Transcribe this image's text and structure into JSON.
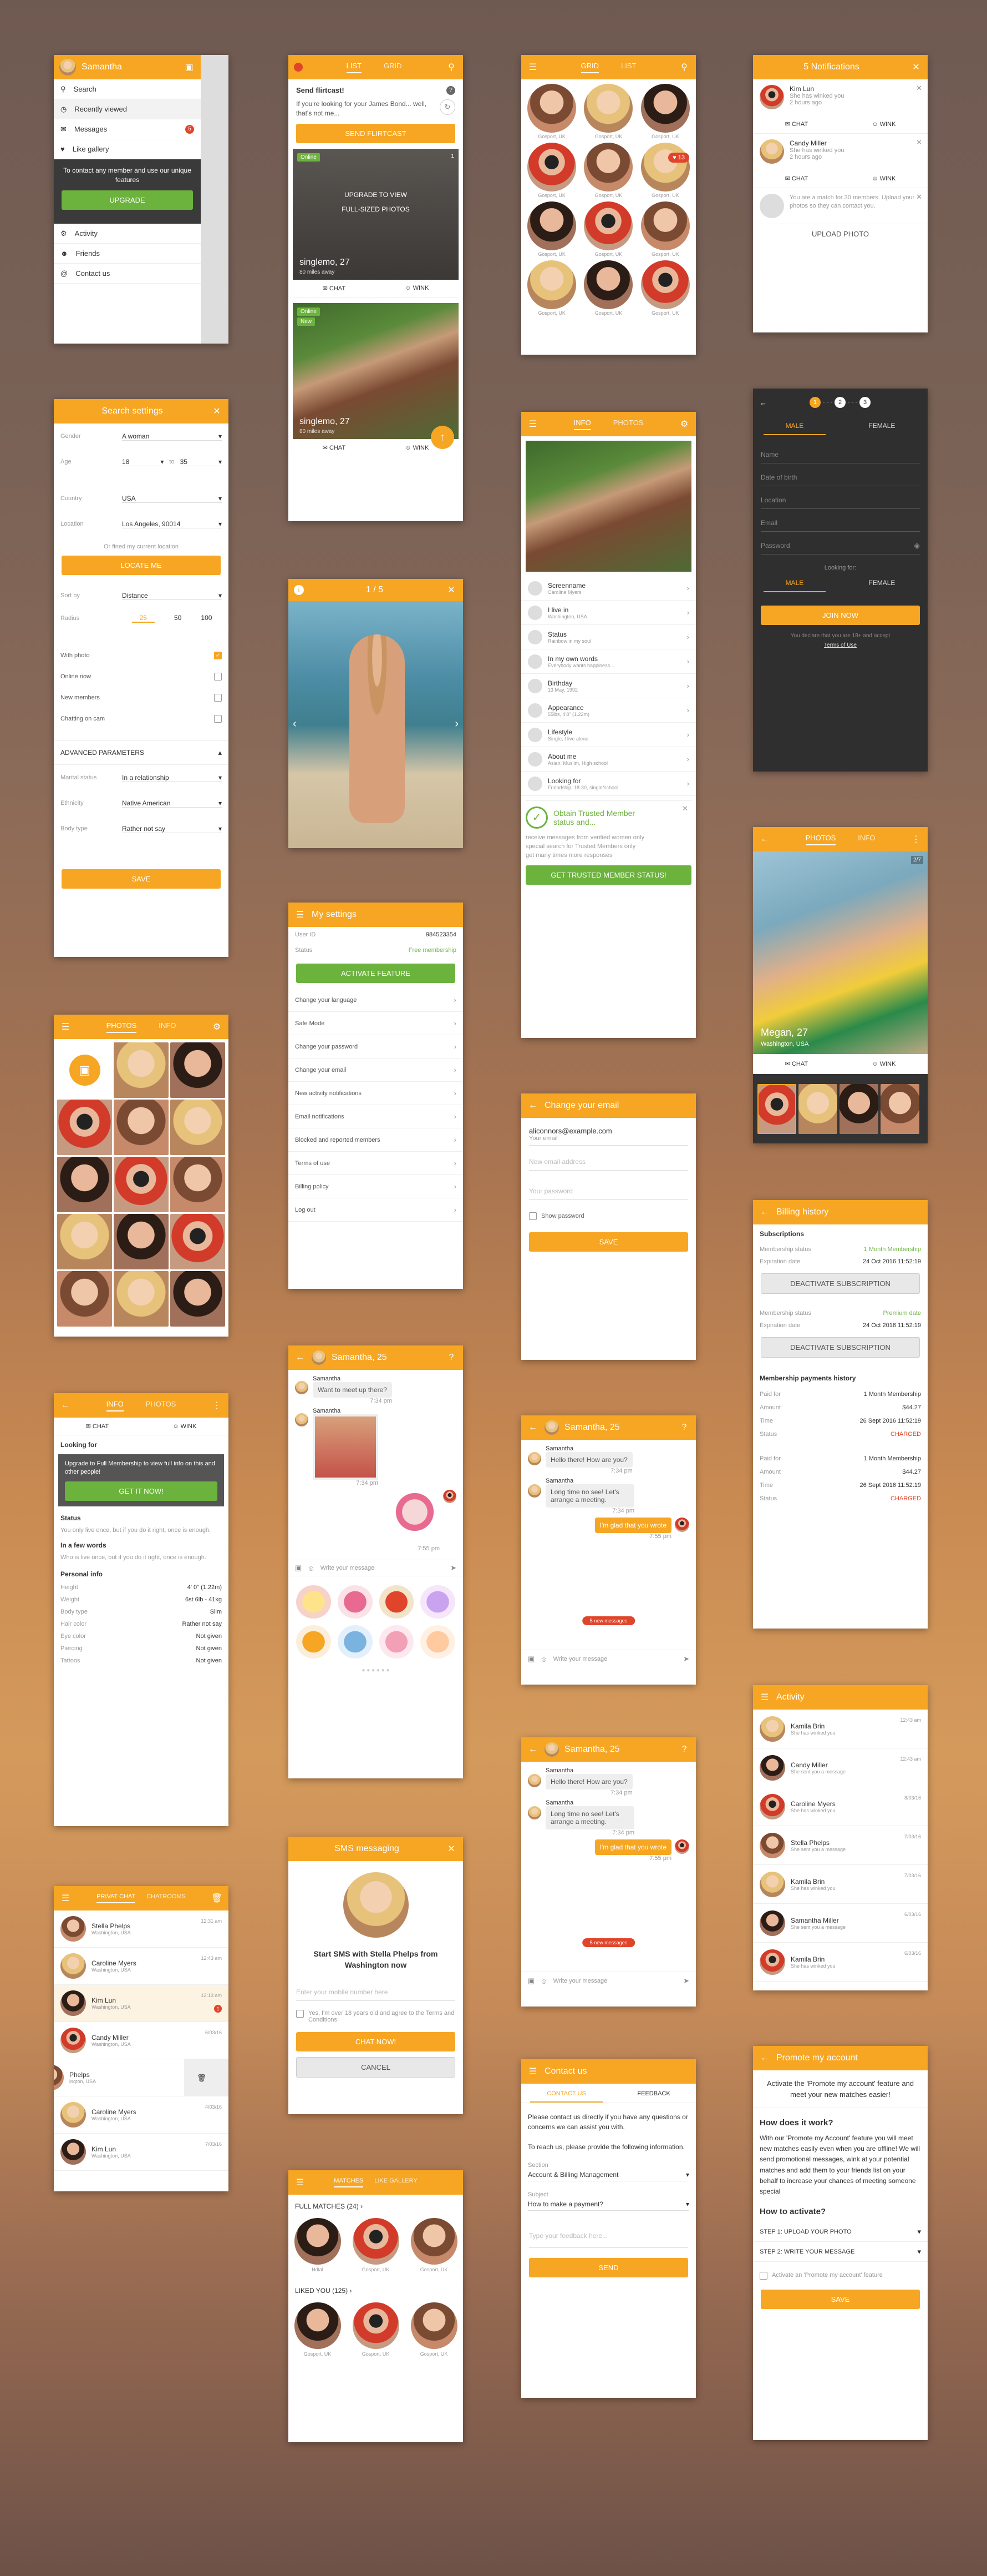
{
  "s1": {
    "user": "Samantha",
    "items": [
      "Search",
      "Recently viewed",
      "Messages",
      "Like gallery"
    ],
    "badge": "5",
    "promo": "To contact any member and use our unique features",
    "upgrade": "UPGRADE",
    "items2": [
      "Activity",
      "Friends",
      "Contact us"
    ]
  },
  "s2": {
    "tab_list": "LIST",
    "tab_grid": "GRID",
    "title": "Send flirtcast!",
    "text": "If you're looking for your James Bond... well, that's not me...",
    "send": "SEND FLIRTCAST",
    "online": "Online",
    "count1": "1",
    "upgrade_text1": "UPGRADE TO VIEW",
    "upgrade_text2": "FULL-SIZED PHOTOS",
    "name1": "singlemo, 27",
    "dist1": "80 miles away",
    "chat": "CHAT",
    "wink": "WINK",
    "new": "New",
    "name2": "singlemo, 27",
    "dist2": "80 miles away"
  },
  "s3": {
    "tab_grid": "GRID",
    "tab_list": "LIST",
    "captions": [
      "Gosport, UK",
      "Gosport, UK",
      "Gosport, UK",
      "Gosport, UK",
      "Gosport, UK",
      "Gosport, UK",
      "Gosport, UK",
      "Gosport, UK",
      "Gosport, UK",
      "Gosport, UK",
      "Gosport, UK",
      "Gosport, UK"
    ],
    "badge": "13"
  },
  "s4": {
    "title": "5 Notifications",
    "n1_name": "Kim Lun",
    "n1_text": "She has winked you",
    "n1_time": "2 hours ago",
    "n2_name": "Candy Miller",
    "n2_text": "She has winked you",
    "n2_time": "2 hours ago",
    "n3_text": "You are a match for 30 members. Upload your photos so they can contact you.",
    "chat": "CHAT",
    "wink": "WINK",
    "upload": "UPLOAD PHOTO"
  },
  "s5": {
    "title": "Search settings",
    "gender_l": "Gender",
    "gender_v": "A woman",
    "age_l": "Age",
    "age_from": "18",
    "age_to": "35",
    "to": "to",
    "country_l": "Country",
    "country_v": "USA",
    "location_l": "Location",
    "location_v": "Los Angeles, 90014",
    "hint": "Or fined my current location",
    "locate": "LOCATE ME",
    "sort_l": "Sort by",
    "sort_v": "Distance",
    "radius_l": "Radius",
    "r1": "25",
    "r2": "50",
    "r3": "100",
    "c1": "With photo",
    "c2": "Online now",
    "c3": "New members",
    "c4": "Chatting on cam",
    "adv": "ADVANCED PARAMETERS",
    "m_l": "Marital status",
    "m_v": "In a relationship",
    "e_l": "Ethnicity",
    "e_v": "Native American",
    "b_l": "Body type",
    "b_v": "Rather not say",
    "save": "SAVE"
  },
  "s6": {
    "counter": "1 / 5"
  },
  "s7": {
    "tab_info": "INFO",
    "tab_photos": "PHOTOS",
    "fields": [
      {
        "l": "Screenname",
        "v": "Caroline Myers"
      },
      {
        "l": "I live in",
        "v": "Washington, USA"
      },
      {
        "l": "Status",
        "v": "Rainbow in my soul"
      },
      {
        "l": "In my own words",
        "v": "Everybody wants happiness..."
      },
      {
        "l": "Birthday",
        "v": "13 May, 1992"
      },
      {
        "l": "Appearance",
        "v": "55lbs, 4'8\" (1.22m)"
      },
      {
        "l": "Lifestyle",
        "v": "Single, I live alone"
      },
      {
        "l": "About me",
        "v": "Asian, Muslim, High school"
      },
      {
        "l": "Looking for",
        "v": "Friendship, 18-30, single/school"
      }
    ],
    "trust_title": "Obtain Trusted Member status and...",
    "trust_items": [
      "receive messages from verified women only",
      "special search for Trusted Members only",
      "get many times more responses"
    ],
    "trust_btn": "GET TRUSTED MEMBER STATUS!"
  },
  "s8": {
    "step1": "1",
    "step2": "2",
    "step3": "3",
    "male": "MALE",
    "female": "FEMALE",
    "fields": [
      "Name",
      "Date of birth",
      "Location",
      "Email",
      "Password"
    ],
    "looking": "Looking for:",
    "male2": "MALE",
    "female2": "FEMALE",
    "join": "JOIN NOW",
    "legal": "You declare that you are 18+ and accept",
    "terms": "Terms of Use"
  },
  "s9": {
    "tab_photos": "PHOTOS",
    "tab_info": "INFO",
    "count": "2/7",
    "name": "Megan, 27",
    "loc": "Washington, USA",
    "chat": "CHAT",
    "wink": "WINK"
  },
  "s10": {
    "title": "My settings",
    "uid_l": "User ID",
    "uid_v": "984523354",
    "status_l": "Status",
    "status_v": "Free membership",
    "activate": "ACTIVATE FEATURE",
    "items": [
      "Change your language",
      "Safe Mode",
      "Change your password",
      "Change your email",
      "New activity notifications",
      "Email notifications",
      "Blocked and reported members",
      "Terms of use",
      "Billing policy",
      "Log out"
    ]
  },
  "s11": {
    "tab_photos": "PHOTOS",
    "tab_info": "INFO"
  },
  "s12": {
    "title": "Change your email",
    "email": "aliconnors@example.com",
    "email_l": "Your email",
    "new_ph": "New email address",
    "pw_ph": "Your password",
    "show": "Show password",
    "save": "SAVE"
  },
  "s13": {
    "tab_info": "INFO",
    "tab_photos": "PHOTOS",
    "chat": "CHAT",
    "wink": "WINK",
    "looking": "Looking for",
    "upg": "Upgrade to Full Membership to view full info on this and other people!",
    "getit": "GET IT NOW!",
    "status_h": "Status",
    "status_t": "You only live once, but if you do it right, once is enough.",
    "words_h": "In a few words",
    "words_t": "Who is live once, but if you do it right, once is enough.",
    "pinfo": "Personal info",
    "rows": [
      {
        "l": "Height",
        "v": "4' 0\" (1.22m)"
      },
      {
        "l": "Weight",
        "v": "6st 6lb - 41kg"
      },
      {
        "l": "Body type",
        "v": "Slim"
      },
      {
        "l": "Hair color",
        "v": "Rather not say"
      },
      {
        "l": "Eye color",
        "v": "Not given"
      },
      {
        "l": "Piercing",
        "v": "Not given"
      },
      {
        "l": "Tattoos",
        "v": "Not given"
      }
    ]
  },
  "s14": {
    "title": "Samantha, 25",
    "sender": "Samantha",
    "m1": "Want to meet up there?",
    "t1": "7:34 pm",
    "t2": "7:34 pm",
    "t3": "7:55 pm",
    "input": "Write your message"
  },
  "s15": {
    "title": "Samantha, 25",
    "sender": "Samantha",
    "m1": "Hello there! How are you?",
    "t1": "7:34 pm",
    "m2": "Long time no see! Let's arrange a meeting.",
    "t2": "7:34 pm",
    "m3": "I'm glad that you wrote",
    "t3": "7:55 pm",
    "more": "5 new messages",
    "input": "Write your message"
  },
  "s16": {
    "title": "Billing history",
    "subs": "Subscriptions",
    "ms_l": "Membership status",
    "ms_v": "1 Month Membership",
    "ed_l": "Expiration date",
    "ed_v": "24 Oct 2016 11:52:19",
    "deact": "DEACTIVATE SUBSCRIPTION",
    "ms2_v": "Premium date",
    "ed2_v": "24 Oct 2016 11:52:19",
    "deact2": "DEACTIVATE SUBSCRIPTION",
    "hist": "Membership payments history",
    "p1": [
      {
        "l": "Paid for",
        "v": "1 Month Membership"
      },
      {
        "l": "Amount",
        "v": "$44.27"
      },
      {
        "l": "Time",
        "v": "26 Sept 2016 11:52:19"
      },
      {
        "l": "Status",
        "v": "CHARGED"
      }
    ],
    "p2": [
      {
        "l": "Paid for",
        "v": "1 Month Membership"
      },
      {
        "l": "Amount",
        "v": "$44.27"
      },
      {
        "l": "Time",
        "v": "26 Sept 2016 11:52:19"
      },
      {
        "l": "Status",
        "v": "CHARGED"
      }
    ]
  },
  "s17": {
    "tab_private": "PRIVAT CHAT",
    "tab_rooms": "CHATROOMS",
    "items": [
      {
        "n": "Stella Phelps",
        "s": "Washington, USA",
        "t": "12:31 am"
      },
      {
        "n": "Caroline Myers",
        "s": "Washington, USA",
        "t": "12:43 am"
      },
      {
        "n": "Kim Lun",
        "s": "Washington, USA",
        "t": "12:13 am"
      },
      {
        "n": "Candy Miller",
        "s": "Washington, USA",
        "t": "6/03/16"
      },
      {
        "n": "Phelps",
        "s": "ington, USA",
        "t": "6/03/16"
      },
      {
        "n": "Caroline Myers",
        "s": "Washington, USA",
        "t": "4/03/16"
      },
      {
        "n": "Kim Lun",
        "s": "Washington, USA",
        "t": "7/03/16"
      }
    ],
    "badge": "1"
  },
  "s18": {
    "title": "SMS messaging",
    "head": "Start SMS with Stella Phelps from Washington now",
    "ph": "Enter your mobile number here",
    "agree": "Yes, I'm over 18 years old and agree to the Terms and Conditions",
    "chat": "CHAT NOW!",
    "cancel": "CANCEL"
  },
  "s19": {
    "title": "Samantha, 25",
    "sender": "Samantha",
    "m1": "Hello there! How are you?",
    "t1": "7:34 pm",
    "m2": "Long time no see! Let's arrange a meeting.",
    "t2": "7:34 pm",
    "m3": "I'm glad that you wrote",
    "t3": "7:55 pm",
    "more": "5 new messages",
    "input": "Write your message"
  },
  "s20": {
    "title": "Activity",
    "items": [
      {
        "n": "Kamila Brin",
        "s": "She has winked you",
        "t": "12:43 am"
      },
      {
        "n": "Candy Miller",
        "s": "She sent you a message",
        "t": "12:43 am"
      },
      {
        "n": "Caroline Myers",
        "s": "She has winked you",
        "t": "8/03/16"
      },
      {
        "n": "Stella Phelps",
        "s": "She sent you a message",
        "t": "7/03/16"
      },
      {
        "n": "Kamila Brin",
        "s": "She has winked you",
        "t": "7/03/16"
      },
      {
        "n": "Samantha Miller",
        "s": "She sent you a message",
        "t": "6/03/16"
      },
      {
        "n": "Kamila Brin",
        "s": "She has winked you",
        "t": "6/03/16"
      }
    ]
  },
  "s21": {
    "tab_matches": "MATCHES",
    "tab_like": "LIKE GALLERY",
    "full": "FULL MATCHES (24)",
    "liked": "LIKED YOU (125)",
    "caps1": [
      "Hdlal",
      "Gosport, UK",
      "Gosport, UK"
    ],
    "caps2": [
      "Gosport, UK",
      "Gosport, UK",
      "Gosport, UK"
    ]
  },
  "s22": {
    "title": "Contact us",
    "tab_contact": "CONTACT US",
    "tab_feedback": "FEEDBACK",
    "p1": "Please contact us directly if you have any questions or concerns we can assist you with.",
    "p2": "To reach us, please provide the following information.",
    "sec_l": "Section",
    "sec_v": "Account & Billing Management",
    "sub_l": "Subject",
    "sub_v": "How to make a payment?",
    "fb_ph": "Type your feedback here...",
    "send": "SEND"
  },
  "s23": {
    "title": "Promote my account",
    "head": "Activate the 'Promote my account' feature and meet your new matches easier!",
    "how": "How does it work?",
    "how_t": "With our 'Promote my Account' feature you will meet new matches easily even when you are offline! We will send promotional messages, wink at your potential matches and add them to your friends list on your behalf to increase your chances of meeting someone special",
    "act": "How to activate?",
    "st1": "STEP 1: UPLOAD YOUR PHOTO",
    "st2": "STEP 2: WRITE YOUR MESSAGE",
    "chk": "Activate an 'Promote my account' feature",
    "save": "SAVE"
  }
}
